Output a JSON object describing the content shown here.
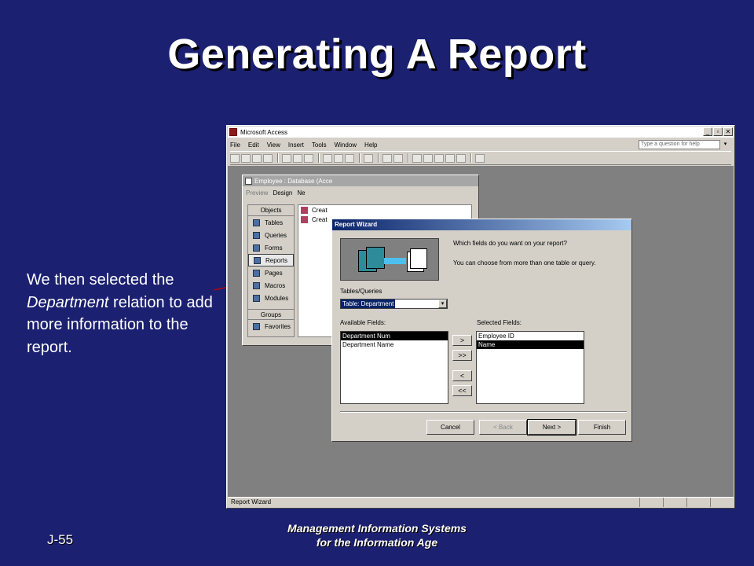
{
  "slide": {
    "title": "Generating A Report",
    "caption_part1": "We then selected the ",
    "caption_italic": "Department",
    "caption_part2": " relation to add more information to the report.",
    "slide_number": "J-55",
    "footer_line1": "Management Information Systems",
    "footer_line2": "for the Information Age",
    "arrow_color": "#cc0000"
  },
  "access": {
    "title": "Microsoft Access",
    "menu": [
      "File",
      "Edit",
      "View",
      "Insert",
      "Tools",
      "Window",
      "Help"
    ],
    "help_placeholder": "Type a question for help",
    "status_text": "Report Wizard",
    "db_window": {
      "title": "Employee : Database (Acce",
      "toolbar": {
        "preview": "Preview",
        "design": "Design",
        "new": "Ne"
      },
      "objects_header": "Objects",
      "objects": [
        "Tables",
        "Queries",
        "Forms",
        "Reports",
        "Pages",
        "Macros",
        "Modules"
      ],
      "groups_header": "Groups",
      "favorites": "Favorites",
      "list": [
        "Creat",
        "Creat"
      ]
    }
  },
  "wizard": {
    "title": "Report Wizard",
    "question": "Which fields do you want on your report?",
    "hint": "You can choose from more than one table or query.",
    "tables_label": "Tables/Queries",
    "table_selected": "Table: Department",
    "available_label": "Available Fields:",
    "selected_label": "Selected Fields:",
    "available_fields": [
      "Department Num",
      "Department Name"
    ],
    "selected_fields": [
      "Employee ID",
      "Name"
    ],
    "move_buttons": [
      ">",
      ">>",
      "<",
      "<<"
    ],
    "buttons": {
      "cancel": "Cancel",
      "back": "< Back",
      "next": "Next >",
      "finish": "Finish"
    }
  }
}
